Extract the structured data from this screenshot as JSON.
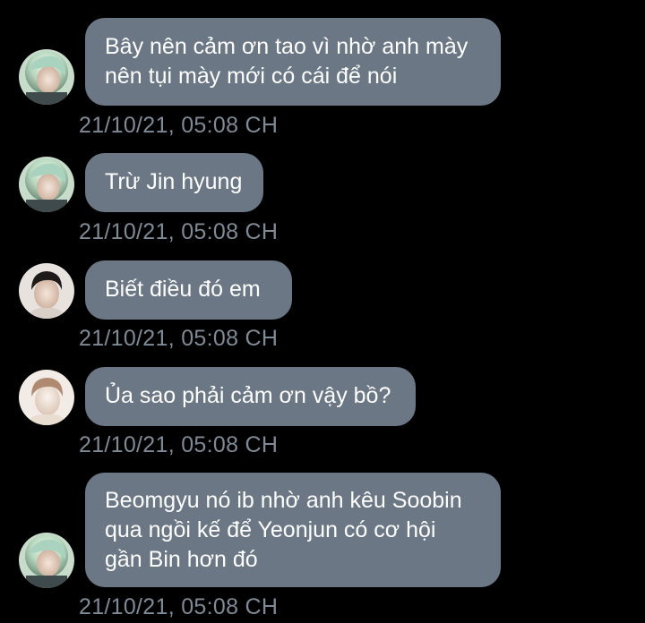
{
  "colors": {
    "background": "#000000",
    "bubble": "#6b7785",
    "bubble_text": "#ffffff",
    "timestamp": "#7f8a97"
  },
  "messages": [
    {
      "avatar": "avatar-mint-hair",
      "lines": [
        "Bây nên cảm ơn tao vì nhờ anh mày",
        "nên tụi mày mới có cái để nói"
      ],
      "timestamp": "21/10/21, 05:08 CH"
    },
    {
      "avatar": "avatar-mint-hair",
      "lines": [
        "Trừ Jin hyung"
      ],
      "timestamp": "21/10/21, 05:08 CH"
    },
    {
      "avatar": "avatar-dark-hair",
      "lines": [
        "Biết điều đó em"
      ],
      "timestamp": "21/10/21, 05:08 CH"
    },
    {
      "avatar": "avatar-light-hair",
      "lines": [
        "Ủa sao phải cảm ơn vậy bồ?"
      ],
      "timestamp": "21/10/21, 05:08 CH"
    },
    {
      "avatar": "avatar-mint-hair",
      "lines": [
        "Beomgyu nó ib nhờ anh kêu Soobin",
        "qua ngồi kế để Yeonjun có cơ hội",
        "gần Bin hơn đó"
      ],
      "timestamp": "21/10/21, 05:08 CH"
    }
  ]
}
